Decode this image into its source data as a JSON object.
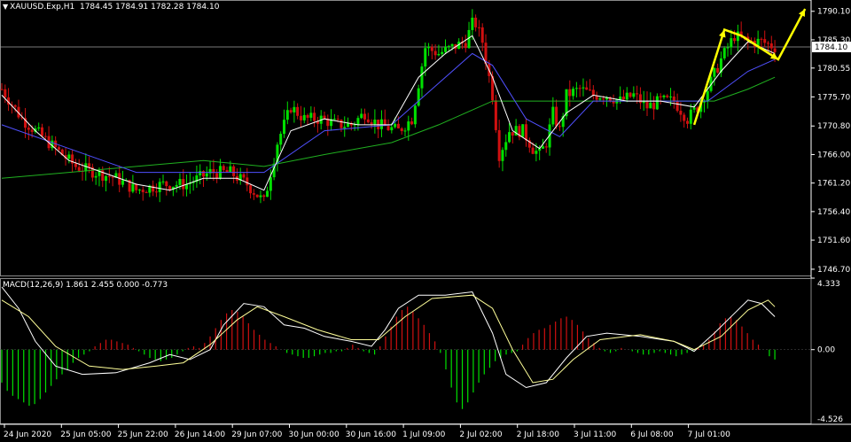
{
  "header": {
    "symbol": "XAUUSD.Exp,H1",
    "ohlc": "1784.45 1784.91 1782.28 1784.10"
  },
  "macd_header": "MACD(12,26,9) 1.861 2.455 0.000 -0.773",
  "colors": {
    "background": "#000000",
    "grid_border": "#ffffff",
    "bull": "#00e000",
    "bear": "#d01010",
    "ma_fast": "#ffffff",
    "ma_mid": "#5050ff",
    "ma_slow": "#20b020",
    "arrow": "#ffff00",
    "macd_signal": "#ffff99"
  },
  "chart_data": [
    {
      "type": "candlestick",
      "title": "XAUUSD.Exp,H1",
      "ylim": [
        1745.5,
        1792.0
      ],
      "price_ticks": [
        "1790.10",
        "1785.30",
        "1780.55",
        "1775.70",
        "1770.80",
        "1766.00",
        "1761.20",
        "1756.40",
        "1751.60",
        "1746.70"
      ],
      "current_price": "1784.10",
      "x_ticks": [
        "24 Jun 2020",
        "25 Jun 05:00",
        "25 Jun 22:00",
        "26 Jun 14:00",
        "29 Jun 07:00",
        "30 Jun 00:00",
        "30 Jun 16:00",
        "1 Jul 09:00",
        "2 Jul 02:00",
        "2 Jul 18:00",
        "3 Jul 11:00",
        "6 Jul 08:00",
        "7 Jul 01:00"
      ],
      "close_path": [
        [
          0,
          1777
        ],
        [
          6,
          1772
        ],
        [
          14,
          1768
        ],
        [
          22,
          1764
        ],
        [
          28,
          1763
        ],
        [
          34,
          1762
        ],
        [
          40,
          1760
        ],
        [
          48,
          1761
        ],
        [
          55,
          1761
        ],
        [
          62,
          1763
        ],
        [
          68,
          1763
        ],
        [
          73,
          1761
        ],
        [
          78,
          1758
        ],
        [
          82,
          1768
        ],
        [
          86,
          1774
        ],
        [
          90,
          1772
        ],
        [
          95,
          1772
        ],
        [
          100,
          1771
        ],
        [
          104,
          1771
        ],
        [
          108,
          1773
        ],
        [
          112,
          1771
        ],
        [
          118,
          1770
        ],
        [
          122,
          1772
        ],
        [
          126,
          1784
        ],
        [
          130,
          1783
        ],
        [
          134,
          1784
        ],
        [
          138,
          1785
        ],
        [
          140,
          1788
        ],
        [
          141,
          1788
        ],
        [
          143,
          1785
        ],
        [
          146,
          1776
        ],
        [
          148,
          1766
        ],
        [
          151,
          1770
        ],
        [
          155,
          1770
        ],
        [
          158,
          1767
        ],
        [
          160,
          1766
        ],
        [
          162,
          1768
        ],
        [
          164,
          1773
        ],
        [
          166,
          1770
        ],
        [
          168,
          1776
        ],
        [
          172,
          1777
        ],
        [
          176,
          1776
        ],
        [
          180,
          1776
        ],
        [
          184,
          1775
        ],
        [
          188,
          1776
        ],
        [
          192,
          1774
        ],
        [
          196,
          1775
        ],
        [
          200,
          1775
        ],
        [
          204,
          1772
        ],
        [
          207,
          1774
        ],
        [
          210,
          1777
        ],
        [
          214,
          1782
        ],
        [
          218,
          1786
        ],
        [
          222,
          1785
        ],
        [
          226,
          1785
        ],
        [
          230,
          1784.1
        ]
      ],
      "ma_fast_path": [
        [
          0,
          1776
        ],
        [
          10,
          1770
        ],
        [
          20,
          1765
        ],
        [
          30,
          1763
        ],
        [
          40,
          1761
        ],
        [
          50,
          1760
        ],
        [
          60,
          1762
        ],
        [
          70,
          1762
        ],
        [
          78,
          1760
        ],
        [
          86,
          1770
        ],
        [
          96,
          1772
        ],
        [
          106,
          1771
        ],
        [
          116,
          1771
        ],
        [
          124,
          1779
        ],
        [
          132,
          1783
        ],
        [
          140,
          1786
        ],
        [
          146,
          1779
        ],
        [
          152,
          1770
        ],
        [
          160,
          1767
        ],
        [
          168,
          1773
        ],
        [
          176,
          1776
        ],
        [
          186,
          1775
        ],
        [
          196,
          1775
        ],
        [
          206,
          1774
        ],
        [
          214,
          1780
        ],
        [
          222,
          1785
        ],
        [
          230,
          1783
        ]
      ],
      "ma_mid_path": [
        [
          0,
          1771
        ],
        [
          20,
          1767
        ],
        [
          40,
          1763
        ],
        [
          60,
          1763
        ],
        [
          78,
          1763
        ],
        [
          96,
          1770
        ],
        [
          116,
          1771
        ],
        [
          130,
          1778
        ],
        [
          140,
          1783
        ],
        [
          146,
          1781
        ],
        [
          156,
          1772
        ],
        [
          166,
          1769
        ],
        [
          176,
          1775
        ],
        [
          196,
          1775
        ],
        [
          210,
          1775
        ],
        [
          222,
          1780
        ],
        [
          230,
          1782
        ]
      ],
      "ma_slow_path": [
        [
          0,
          1762
        ],
        [
          20,
          1763
        ],
        [
          40,
          1764
        ],
        [
          60,
          1765
        ],
        [
          78,
          1764
        ],
        [
          96,
          1766
        ],
        [
          116,
          1768
        ],
        [
          130,
          1771
        ],
        [
          146,
          1775
        ],
        [
          160,
          1775
        ],
        [
          180,
          1775
        ],
        [
          196,
          1775
        ],
        [
          212,
          1775
        ],
        [
          222,
          1777
        ],
        [
          230,
          1779
        ]
      ],
      "projection_arrow": [
        [
          206,
          1771
        ],
        [
          215,
          1787
        ],
        [
          220,
          1786
        ],
        [
          231,
          1782
        ],
        [
          239,
          1790.5
        ]
      ]
    },
    {
      "type": "macd",
      "title": "MACD(12,26,9)",
      "ylim": [
        -4.526,
        4.333
      ],
      "y_ticks": [
        "4.333",
        "0.00",
        "-4.526"
      ],
      "histogram": [
        -2,
        -2.5,
        -2.8,
        -3,
        -3.2,
        -3.4,
        -3.3,
        -3,
        -2.6,
        -2.2,
        -1.8,
        -1.5,
        -1.2,
        -0.8,
        -0.5,
        -0.3,
        -0.1,
        0.2,
        0.4,
        0.6,
        0.6,
        0.5,
        0.4,
        0.3,
        0.1,
        -0.1,
        -0.3,
        -0.5,
        -0.6,
        -0.7,
        -0.6,
        -0.5,
        -0.3,
        -0.1,
        0.1,
        0.2,
        0.1,
        0.4,
        0.8,
        1.3,
        1.8,
        2.2,
        2.4,
        2.3,
        2,
        1.6,
        1.2,
        0.9,
        0.6,
        0.4,
        0.2,
        0,
        -0.2,
        -0.3,
        -0.4,
        -0.5,
        -0.5,
        -0.4,
        -0.3,
        -0.2,
        -0.2,
        -0.1,
        -0.1,
        0.1,
        0.3,
        0.1,
        -0.1,
        -0.2,
        -0.3,
        0.2,
        0.8,
        1.4,
        2,
        2.4,
        2.6,
        2.3,
        1.9,
        1.5,
        1,
        0.5,
        -0.2,
        -1.2,
        -2.3,
        -3.2,
        -3.6,
        -3.2,
        -2.6,
        -2,
        -1.5,
        -1.1,
        -0.7,
        -0.5,
        -0.3,
        -0.2,
        -0.1,
        0.3,
        0.7,
        1,
        1.2,
        1.3,
        1.5,
        1.7,
        1.9,
        2,
        1.8,
        1.5,
        1.1,
        0.7,
        0.4,
        0.1,
        -0.1,
        -0.2,
        -0.1,
        0.1,
        0,
        -0.1,
        -0.2,
        -0.3,
        -0.3,
        -0.2,
        -0.1,
        -0.2,
        -0.3,
        -0.4,
        -0.3,
        -0.2,
        -0.1,
        0.1,
        0.3,
        0.6,
        1.1,
        1.6,
        1.9,
        2,
        1.8,
        1.4,
        1,
        0.6,
        0.3,
        0,
        -0.4,
        -0.6
      ],
      "macd_path": [
        [
          0,
          3.8
        ],
        [
          5,
          2.5
        ],
        [
          10,
          0.5
        ],
        [
          16,
          -1
        ],
        [
          24,
          -1.5
        ],
        [
          34,
          -1.4
        ],
        [
          44,
          -0.8
        ],
        [
          50,
          -0.3
        ],
        [
          56,
          -0.6
        ],
        [
          62,
          0
        ],
        [
          66,
          1.5
        ],
        [
          72,
          2.8
        ],
        [
          78,
          2.6
        ],
        [
          84,
          1.5
        ],
        [
          90,
          1.3
        ],
        [
          96,
          0.8
        ],
        [
          104,
          0.5
        ],
        [
          110,
          0.2
        ],
        [
          114,
          1.2
        ],
        [
          118,
          2.5
        ],
        [
          124,
          3.3
        ],
        [
          132,
          3.3
        ],
        [
          140,
          3.5
        ],
        [
          146,
          1
        ],
        [
          150,
          -1.5
        ],
        [
          156,
          -2.3
        ],
        [
          162,
          -2
        ],
        [
          168,
          -0.5
        ],
        [
          174,
          0.8
        ],
        [
          180,
          1
        ],
        [
          190,
          0.8
        ],
        [
          200,
          0.5
        ],
        [
          206,
          -0.1
        ],
        [
          212,
          1
        ],
        [
          218,
          2.2
        ],
        [
          222,
          3
        ],
        [
          226,
          2.8
        ],
        [
          230,
          2
        ]
      ],
      "signal_path": [
        [
          0,
          3
        ],
        [
          8,
          2
        ],
        [
          16,
          0.2
        ],
        [
          26,
          -1
        ],
        [
          36,
          -1.2
        ],
        [
          46,
          -1
        ],
        [
          54,
          -0.8
        ],
        [
          62,
          0.3
        ],
        [
          70,
          1.8
        ],
        [
          76,
          2.6
        ],
        [
          84,
          2
        ],
        [
          94,
          1.2
        ],
        [
          104,
          0.6
        ],
        [
          112,
          0.6
        ],
        [
          120,
          2
        ],
        [
          128,
          3.1
        ],
        [
          140,
          3.3
        ],
        [
          146,
          2.5
        ],
        [
          152,
          0
        ],
        [
          158,
          -2
        ],
        [
          164,
          -1.8
        ],
        [
          170,
          -0.6
        ],
        [
          178,
          0.6
        ],
        [
          190,
          0.9
        ],
        [
          200,
          0.5
        ],
        [
          206,
          0
        ],
        [
          214,
          0.8
        ],
        [
          222,
          2.4
        ],
        [
          228,
          3
        ],
        [
          230,
          2.6
        ]
      ]
    }
  ]
}
